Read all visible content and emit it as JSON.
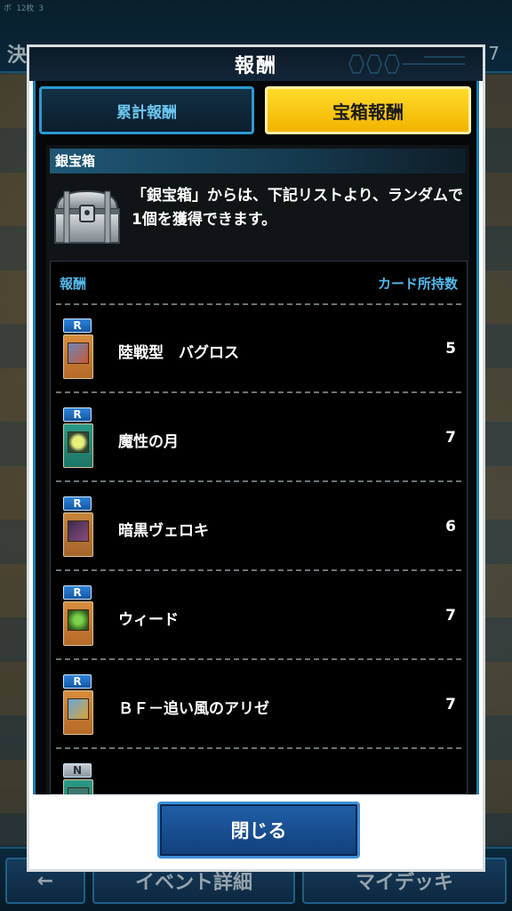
{
  "background": {
    "status_text": "ボ 12枚 3",
    "title": "決闘",
    "number": "7",
    "back_label": "←",
    "event_label": "イベント詳細",
    "deck_label": "マイデッキ"
  },
  "modal": {
    "title": "報酬",
    "tabs": [
      {
        "label": "累計報酬",
        "active": false
      },
      {
        "label": "宝箱報酬",
        "active": true
      }
    ],
    "section_label": "銀宝箱",
    "description": "「銀宝箱」からは、下記リストより、ランダムで1個を獲得できます。",
    "list": {
      "header_reward": "報酬",
      "header_owned": "カード所持数",
      "items": [
        {
          "rarity": "R",
          "name": "陸戦型　バグロス",
          "count": "5"
        },
        {
          "rarity": "R",
          "name": "魔性の月",
          "count": "7"
        },
        {
          "rarity": "R",
          "name": "暗黒ヴェロキ",
          "count": "6"
        },
        {
          "rarity": "R",
          "name": "ウィード",
          "count": "7"
        },
        {
          "rarity": "R",
          "name": "ＢＦ－追い風のアリゼ",
          "count": "7"
        },
        {
          "rarity": "N",
          "name": "",
          "count": ""
        }
      ]
    },
    "close_label": "閉じる"
  },
  "colors": {
    "accent_blue": "#2a9ad2",
    "active_tab": "#ffdb2a",
    "header_text": "#54b8ea"
  }
}
